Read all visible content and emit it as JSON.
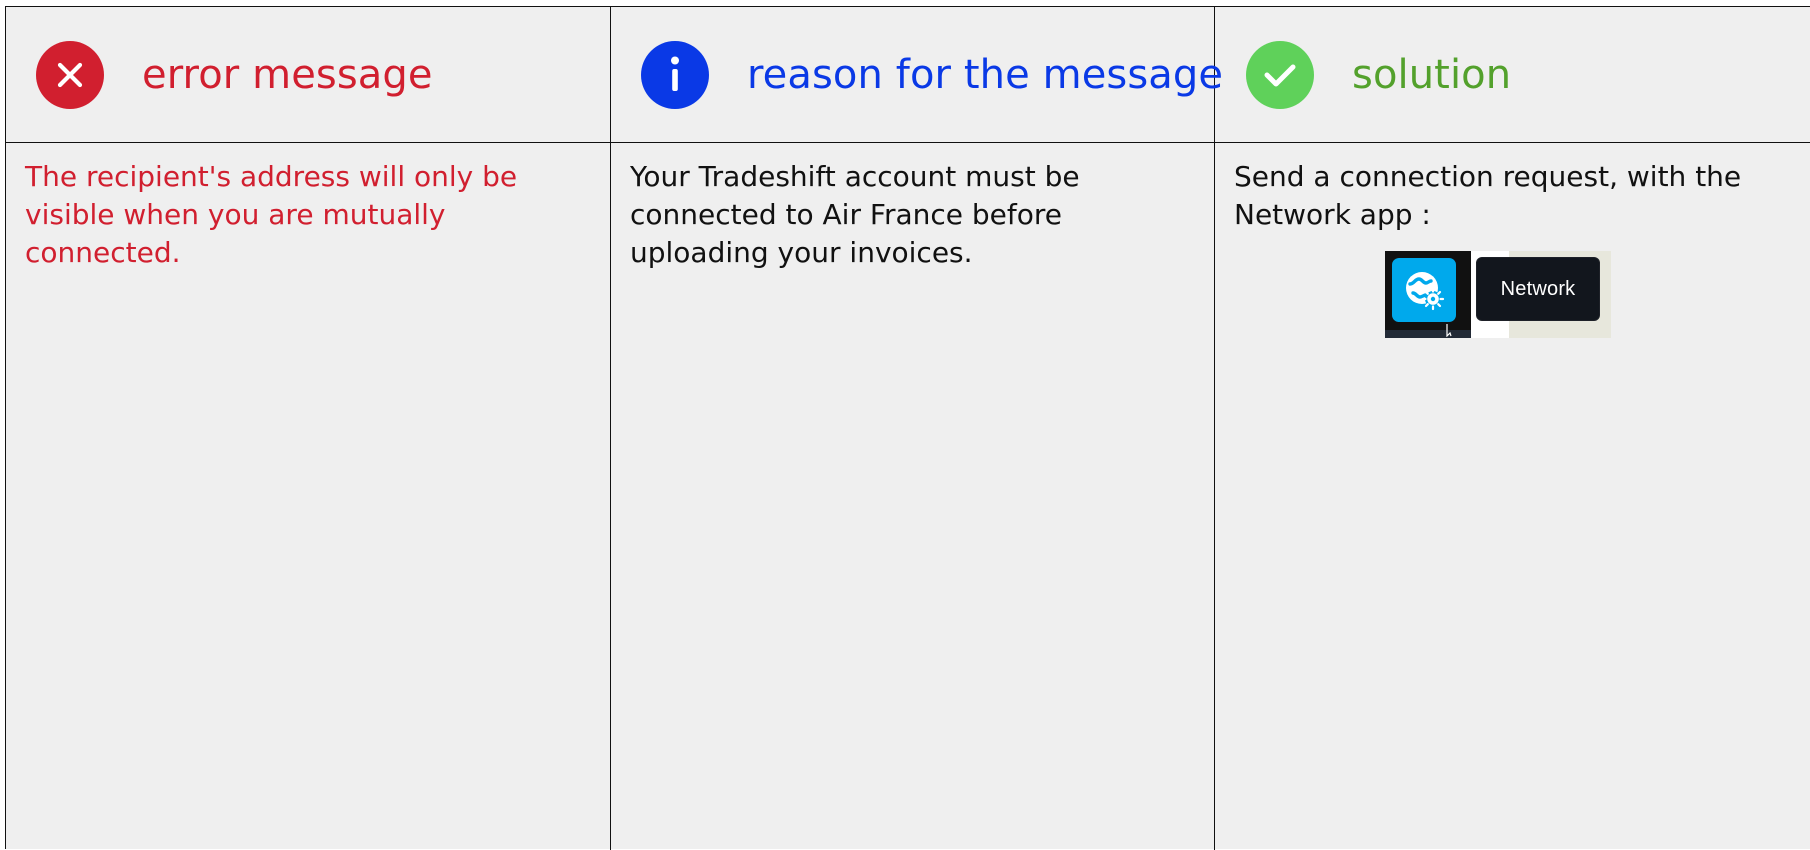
{
  "headers": {
    "error": "error message",
    "reason": "reason for the message",
    "solution": "solution"
  },
  "colors": {
    "error": "#d11f2f",
    "reason": "#0a39e6",
    "solution": "#5fba3a",
    "solution_text": "#53a12c",
    "icon_error": "#d11f2f",
    "icon_reason": "#0a39e6",
    "icon_solution": "#5fd15a"
  },
  "rows": [
    {
      "error_text": "The recipient's address will only be visible when you are mutually connected.",
      "reason_text": "Your Tradeshift account must be connected to Air France before uploading your invoices.",
      "solution_text": "Send a connection request, with the Network app :"
    }
  ],
  "network_preview": {
    "tooltip_label": "Network",
    "icon": "network-globe-icon"
  },
  "icons": {
    "error": "close-circle-icon",
    "reason": "info-circle-icon",
    "solution": "check-circle-icon"
  }
}
